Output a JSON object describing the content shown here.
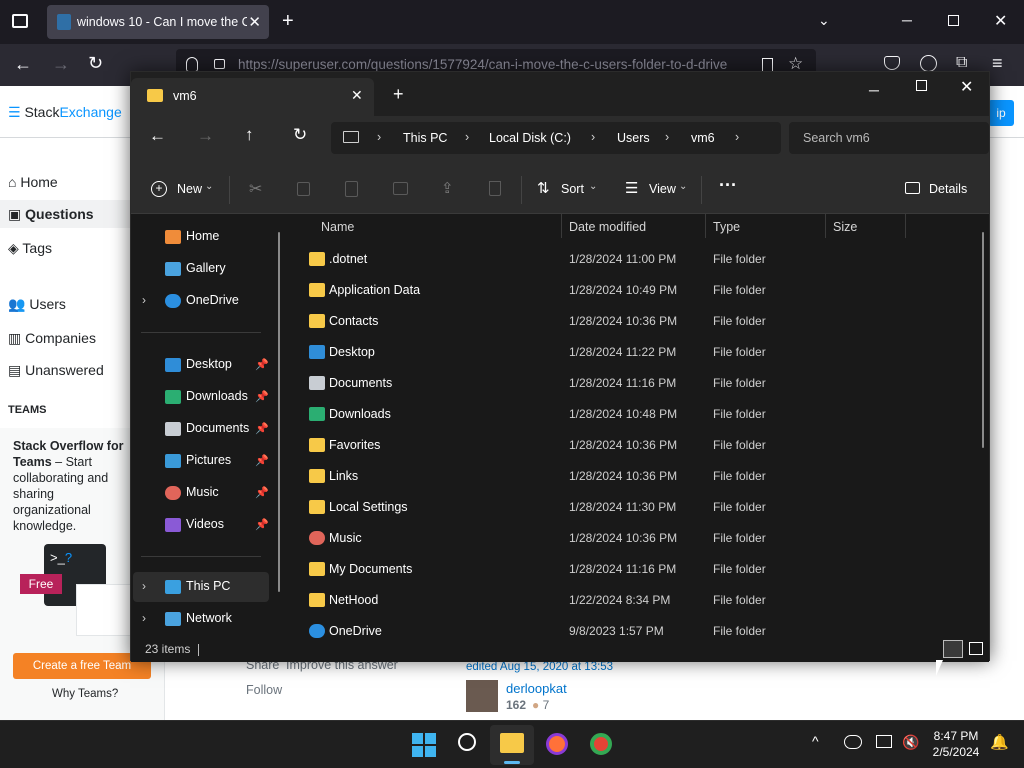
{
  "browser": {
    "tab_title": "windows 10 - Can I move the C",
    "url": "https://superuser.com/questions/1577924/can-i-move-the-c-users-folder-to-d-drive"
  },
  "se": {
    "logo_a": "Stack",
    "logo_b": "Exchange",
    "nav": {
      "home": "Home",
      "questions": "Questions",
      "tags": "Tags",
      "users": "Users",
      "companies": "Companies",
      "unanswered": "Unanswered"
    },
    "teams_label": "TEAMS",
    "teams_title": "Stack Overflow for Teams",
    "teams_desc": "– Start collaborating and sharing organizational knowledge.",
    "free_badge": "Free",
    "create_team": "Create a free Team",
    "why_teams": "Why Teams?",
    "share": "Share",
    "improve": "Improve this answer",
    "follow": "Follow",
    "edited": "edited Aug 15, 2020 at 13:53",
    "user_name": "derloopkat",
    "user_rep": "162",
    "user_bronze": "7",
    "sign_up_frag": "ip"
  },
  "explorer": {
    "tab_title": "vm6",
    "breadcrumb": [
      "This PC",
      "Local Disk (C:)",
      "Users",
      "vm6"
    ],
    "search_placeholder": "Search vm6",
    "toolbar": {
      "new": "New",
      "sort": "Sort",
      "view": "View",
      "details": "Details"
    },
    "nav": {
      "home": "Home",
      "gallery": "Gallery",
      "onedrive": "OneDrive",
      "desktop": "Desktop",
      "downloads": "Downloads",
      "documents": "Documents",
      "pictures": "Pictures",
      "music": "Music",
      "videos": "Videos",
      "this_pc": "This PC",
      "network": "Network"
    },
    "columns": {
      "name": "Name",
      "date": "Date modified",
      "type": "Type",
      "size": "Size"
    },
    "files": [
      {
        "name": ".dotnet",
        "date": "1/28/2024 11:00 PM",
        "type": "File folder",
        "icon": "folder-icon"
      },
      {
        "name": "Application Data",
        "date": "1/28/2024 10:49 PM",
        "type": "File folder",
        "icon": "shortcut-folder-icon"
      },
      {
        "name": "Contacts",
        "date": "1/28/2024 10:36 PM",
        "type": "File folder",
        "icon": "folder-icon"
      },
      {
        "name": "Desktop",
        "date": "1/28/2024 11:22 PM",
        "type": "File folder",
        "icon": "desktop-icon"
      },
      {
        "name": "Documents",
        "date": "1/28/2024 11:16 PM",
        "type": "File folder",
        "icon": "documents-icon"
      },
      {
        "name": "Downloads",
        "date": "1/28/2024 10:48 PM",
        "type": "File folder",
        "icon": "downloads-icon"
      },
      {
        "name": "Favorites",
        "date": "1/28/2024 10:36 PM",
        "type": "File folder",
        "icon": "folder-icon"
      },
      {
        "name": "Links",
        "date": "1/28/2024 10:36 PM",
        "type": "File folder",
        "icon": "folder-icon"
      },
      {
        "name": "Local Settings",
        "date": "1/28/2024 11:30 PM",
        "type": "File folder",
        "icon": "shortcut-folder-icon"
      },
      {
        "name": "Music",
        "date": "1/28/2024 10:36 PM",
        "type": "File folder",
        "icon": "music-icon"
      },
      {
        "name": "My Documents",
        "date": "1/28/2024 11:16 PM",
        "type": "File folder",
        "icon": "shortcut-folder-icon"
      },
      {
        "name": "NetHood",
        "date": "1/22/2024 8:34 PM",
        "type": "File folder",
        "icon": "shortcut-folder-icon"
      },
      {
        "name": "OneDrive",
        "date": "9/8/2023 1:57 PM",
        "type": "File folder",
        "icon": "onedrive-icon"
      }
    ],
    "status_count": "23 items"
  },
  "taskbar": {
    "time": "8:47 PM",
    "date": "2/5/2024"
  },
  "colors": {
    "folder": "#f7c948",
    "accent": "#0a95ff",
    "orange": "#f48225",
    "explorer_bg": "#191919"
  }
}
